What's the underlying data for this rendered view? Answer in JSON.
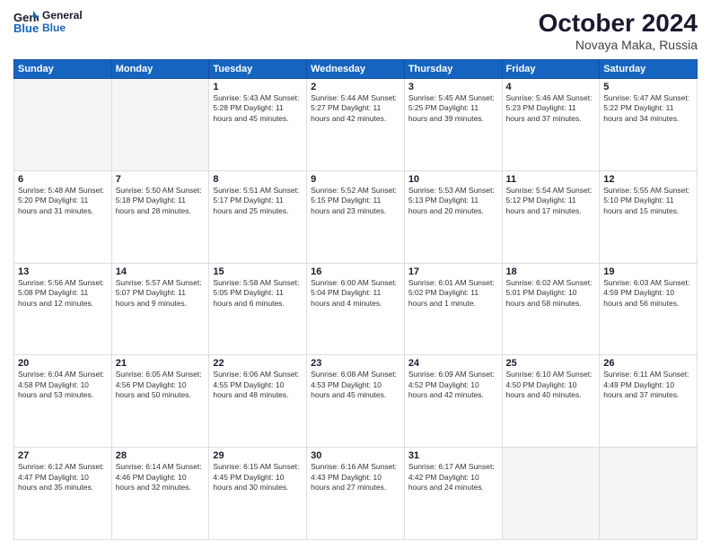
{
  "header": {
    "logo_line1": "General",
    "logo_line2": "Blue",
    "month": "October 2024",
    "location": "Novaya Maka, Russia"
  },
  "weekdays": [
    "Sunday",
    "Monday",
    "Tuesday",
    "Wednesday",
    "Thursday",
    "Friday",
    "Saturday"
  ],
  "weeks": [
    [
      {
        "day": "",
        "info": ""
      },
      {
        "day": "",
        "info": ""
      },
      {
        "day": "1",
        "info": "Sunrise: 5:43 AM\nSunset: 5:28 PM\nDaylight: 11 hours and 45 minutes."
      },
      {
        "day": "2",
        "info": "Sunrise: 5:44 AM\nSunset: 5:27 PM\nDaylight: 11 hours and 42 minutes."
      },
      {
        "day": "3",
        "info": "Sunrise: 5:45 AM\nSunset: 5:25 PM\nDaylight: 11 hours and 39 minutes."
      },
      {
        "day": "4",
        "info": "Sunrise: 5:46 AM\nSunset: 5:23 PM\nDaylight: 11 hours and 37 minutes."
      },
      {
        "day": "5",
        "info": "Sunrise: 5:47 AM\nSunset: 5:22 PM\nDaylight: 11 hours and 34 minutes."
      }
    ],
    [
      {
        "day": "6",
        "info": "Sunrise: 5:48 AM\nSunset: 5:20 PM\nDaylight: 11 hours and 31 minutes."
      },
      {
        "day": "7",
        "info": "Sunrise: 5:50 AM\nSunset: 5:18 PM\nDaylight: 11 hours and 28 minutes."
      },
      {
        "day": "8",
        "info": "Sunrise: 5:51 AM\nSunset: 5:17 PM\nDaylight: 11 hours and 25 minutes."
      },
      {
        "day": "9",
        "info": "Sunrise: 5:52 AM\nSunset: 5:15 PM\nDaylight: 11 hours and 23 minutes."
      },
      {
        "day": "10",
        "info": "Sunrise: 5:53 AM\nSunset: 5:13 PM\nDaylight: 11 hours and 20 minutes."
      },
      {
        "day": "11",
        "info": "Sunrise: 5:54 AM\nSunset: 5:12 PM\nDaylight: 11 hours and 17 minutes."
      },
      {
        "day": "12",
        "info": "Sunrise: 5:55 AM\nSunset: 5:10 PM\nDaylight: 11 hours and 15 minutes."
      }
    ],
    [
      {
        "day": "13",
        "info": "Sunrise: 5:56 AM\nSunset: 5:08 PM\nDaylight: 11 hours and 12 minutes."
      },
      {
        "day": "14",
        "info": "Sunrise: 5:57 AM\nSunset: 5:07 PM\nDaylight: 11 hours and 9 minutes."
      },
      {
        "day": "15",
        "info": "Sunrise: 5:58 AM\nSunset: 5:05 PM\nDaylight: 11 hours and 6 minutes."
      },
      {
        "day": "16",
        "info": "Sunrise: 6:00 AM\nSunset: 5:04 PM\nDaylight: 11 hours and 4 minutes."
      },
      {
        "day": "17",
        "info": "Sunrise: 6:01 AM\nSunset: 5:02 PM\nDaylight: 11 hours and 1 minute."
      },
      {
        "day": "18",
        "info": "Sunrise: 6:02 AM\nSunset: 5:01 PM\nDaylight: 10 hours and 58 minutes."
      },
      {
        "day": "19",
        "info": "Sunrise: 6:03 AM\nSunset: 4:59 PM\nDaylight: 10 hours and 56 minutes."
      }
    ],
    [
      {
        "day": "20",
        "info": "Sunrise: 6:04 AM\nSunset: 4:58 PM\nDaylight: 10 hours and 53 minutes."
      },
      {
        "day": "21",
        "info": "Sunrise: 6:05 AM\nSunset: 4:56 PM\nDaylight: 10 hours and 50 minutes."
      },
      {
        "day": "22",
        "info": "Sunrise: 6:06 AM\nSunset: 4:55 PM\nDaylight: 10 hours and 48 minutes."
      },
      {
        "day": "23",
        "info": "Sunrise: 6:08 AM\nSunset: 4:53 PM\nDaylight: 10 hours and 45 minutes."
      },
      {
        "day": "24",
        "info": "Sunrise: 6:09 AM\nSunset: 4:52 PM\nDaylight: 10 hours and 42 minutes."
      },
      {
        "day": "25",
        "info": "Sunrise: 6:10 AM\nSunset: 4:50 PM\nDaylight: 10 hours and 40 minutes."
      },
      {
        "day": "26",
        "info": "Sunrise: 6:11 AM\nSunset: 4:49 PM\nDaylight: 10 hours and 37 minutes."
      }
    ],
    [
      {
        "day": "27",
        "info": "Sunrise: 6:12 AM\nSunset: 4:47 PM\nDaylight: 10 hours and 35 minutes."
      },
      {
        "day": "28",
        "info": "Sunrise: 6:14 AM\nSunset: 4:46 PM\nDaylight: 10 hours and 32 minutes."
      },
      {
        "day": "29",
        "info": "Sunrise: 6:15 AM\nSunset: 4:45 PM\nDaylight: 10 hours and 30 minutes."
      },
      {
        "day": "30",
        "info": "Sunrise: 6:16 AM\nSunset: 4:43 PM\nDaylight: 10 hours and 27 minutes."
      },
      {
        "day": "31",
        "info": "Sunrise: 6:17 AM\nSunset: 4:42 PM\nDaylight: 10 hours and 24 minutes."
      },
      {
        "day": "",
        "info": ""
      },
      {
        "day": "",
        "info": ""
      }
    ]
  ]
}
